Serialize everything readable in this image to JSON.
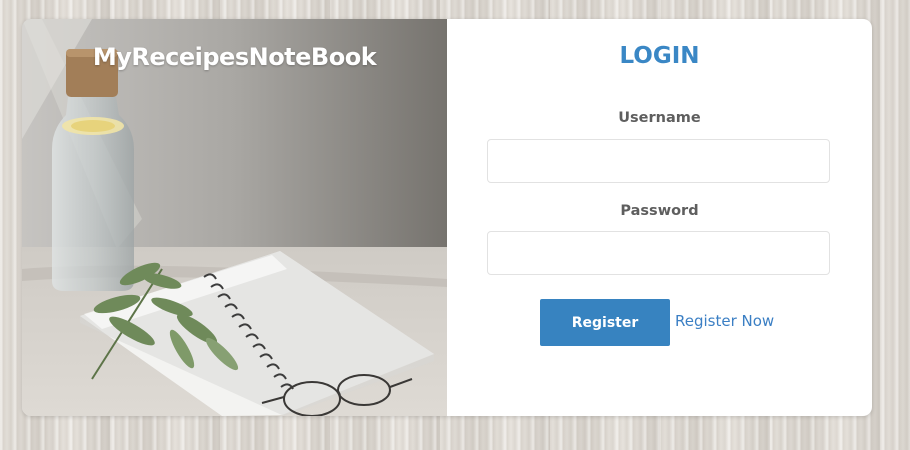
{
  "brand": {
    "title": "MyReceipesNoteBook"
  },
  "login": {
    "title": "LOGIN",
    "username_label": "Username",
    "username_value": "",
    "password_label": "Password",
    "password_value": "",
    "register_button": "Register",
    "register_link": "Register Now"
  },
  "colors": {
    "accent": "#3a87c5",
    "button": "#3783c0",
    "link": "#3b7fc4"
  }
}
